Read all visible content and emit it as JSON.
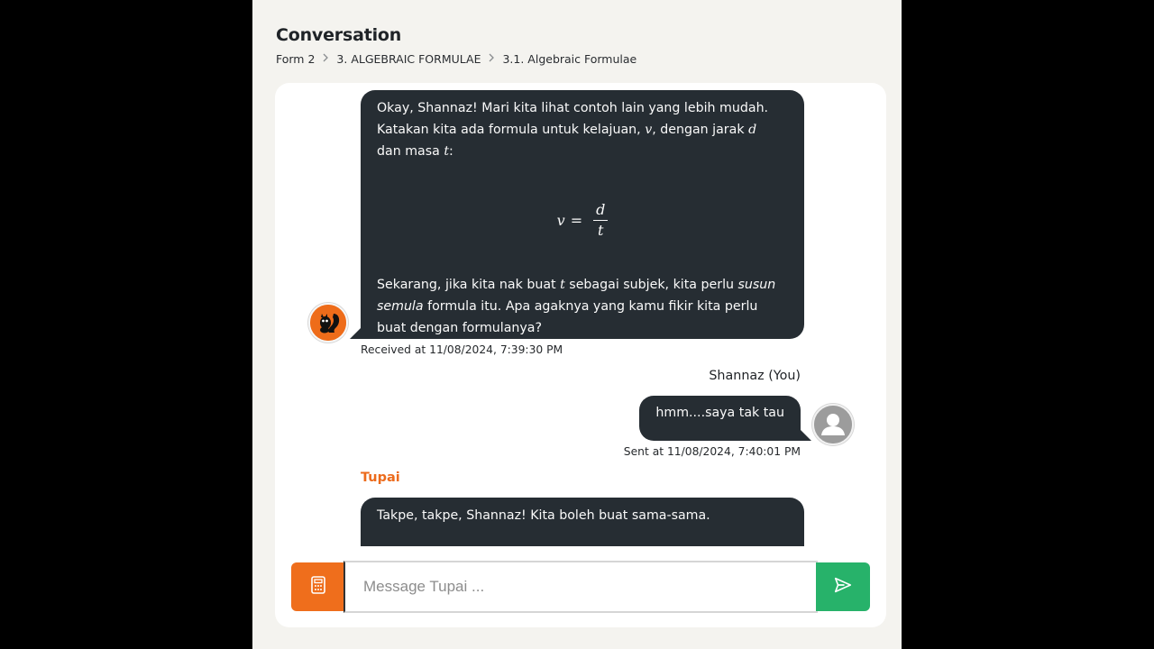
{
  "page": {
    "title": "Conversation"
  },
  "breadcrumb": [
    "Form 2",
    "3. ALGEBRAIC FORMULAE",
    "3.1. Algebraic Formulae"
  ],
  "messages": {
    "bot1": {
      "p1_l1": "Okay, Shannaz! Mari kita lihat contoh lain yang lebih mudah.",
      "p1_l2a": "Katakan kita ada formula untuk kelajuan, ",
      "p1_l2_v": "v",
      "p1_l2b": ", dengan jarak ",
      "p1_l2_d": "d",
      "p1_l3a": "dan masa ",
      "p1_l3_t": "t",
      "p1_l3b": ":",
      "formula": {
        "lhs": "v",
        "eq": "=",
        "num": "d",
        "den": "t"
      },
      "p2_l1a": "Sekarang, jika kita nak buat ",
      "p2_l1_t": "t",
      "p2_l1b": " sebagai subjek, kita perlu ",
      "p2_l1_em": "susun",
      "p2_l2_em": "semula",
      "p2_l2b": " formula itu. Apa agaknya yang kamu fikir kita perlu",
      "p2_l3": "buat dengan formulanya?",
      "meta": "Received at 11/08/2024, 7:39:30 PM"
    },
    "user1": {
      "name": "Shannaz (You)",
      "text": "hmm....saya tak tau",
      "meta": "Sent at 11/08/2024, 7:40:01 PM"
    },
    "bot2": {
      "name": "Tupai",
      "text": "Takpe, takpe, Shannaz! Kita boleh buat sama-sama."
    }
  },
  "composer": {
    "placeholder": "Message Tupai ...",
    "value": ""
  },
  "icons": {
    "bot_avatar": "squirrel-icon",
    "user_avatar": "user-icon",
    "calculator": "calculator-icon",
    "send": "send-icon",
    "breadcrumb_separator": "chevron-right-icon"
  },
  "colors": {
    "accent": "#ec6b1c",
    "bubble": "#262d33",
    "send": "#27b26a",
    "background": "#f4f3ef"
  }
}
